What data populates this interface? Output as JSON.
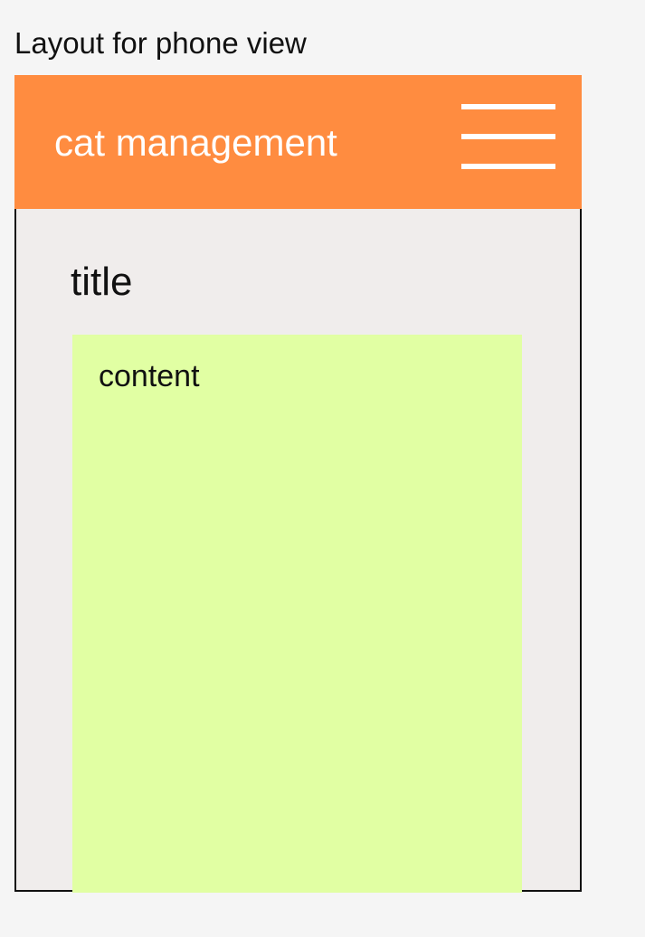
{
  "frame_caption": "Layout for phone view",
  "header": {
    "title": "cat management",
    "menu_icon": "hamburger-menu-icon"
  },
  "main": {
    "title": "title",
    "content_label": "content"
  },
  "colors": {
    "page_background": "#f5f5f5",
    "header_background": "#ff8c40",
    "header_text": "#ffffff",
    "screen_background": "#f0edec",
    "content_background": "#e1ffa3",
    "border": "#111111",
    "text": "#111111"
  }
}
